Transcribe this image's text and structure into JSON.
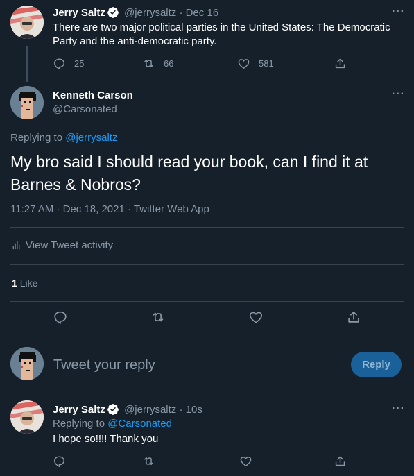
{
  "tweet1": {
    "name": "Jerry Saltz",
    "handle": "@jerrysaltz",
    "date": "· Dec 16",
    "text": "There are two major political parties in the United States: The  Democratic Party and the anti-democratic party.",
    "replies": "25",
    "retweets": "66",
    "likes": "581"
  },
  "main": {
    "name": "Kenneth Carson",
    "handle": "@Carsonated",
    "replying_prefix": "Replying to ",
    "replying_to": "@jerrysaltz",
    "text": "My bro said I should read your book, can I find it at Barnes & Nobros?",
    "timestamp": "11:27 AM · Dec 18, 2021 · Twitter Web App",
    "activity_label": "View Tweet activity",
    "like_count": "1",
    "like_label": "Like"
  },
  "compose": {
    "placeholder": "Tweet your reply",
    "button": "Reply"
  },
  "reply": {
    "name": "Jerry Saltz",
    "handle": "@jerrysaltz",
    "date": "· 10s",
    "replying_prefix": "Replying to ",
    "replying_to": "@Carsonated",
    "text": "I hope so!!!! Thank you"
  },
  "colors": {
    "background": "#15202b",
    "accent": "#1d9bf0",
    "muted": "#8b98a5",
    "divider": "#38444d"
  },
  "icons": [
    "reply-icon",
    "retweet-icon",
    "like-icon",
    "share-icon",
    "more-icon",
    "verified-icon",
    "activity-icon"
  ]
}
